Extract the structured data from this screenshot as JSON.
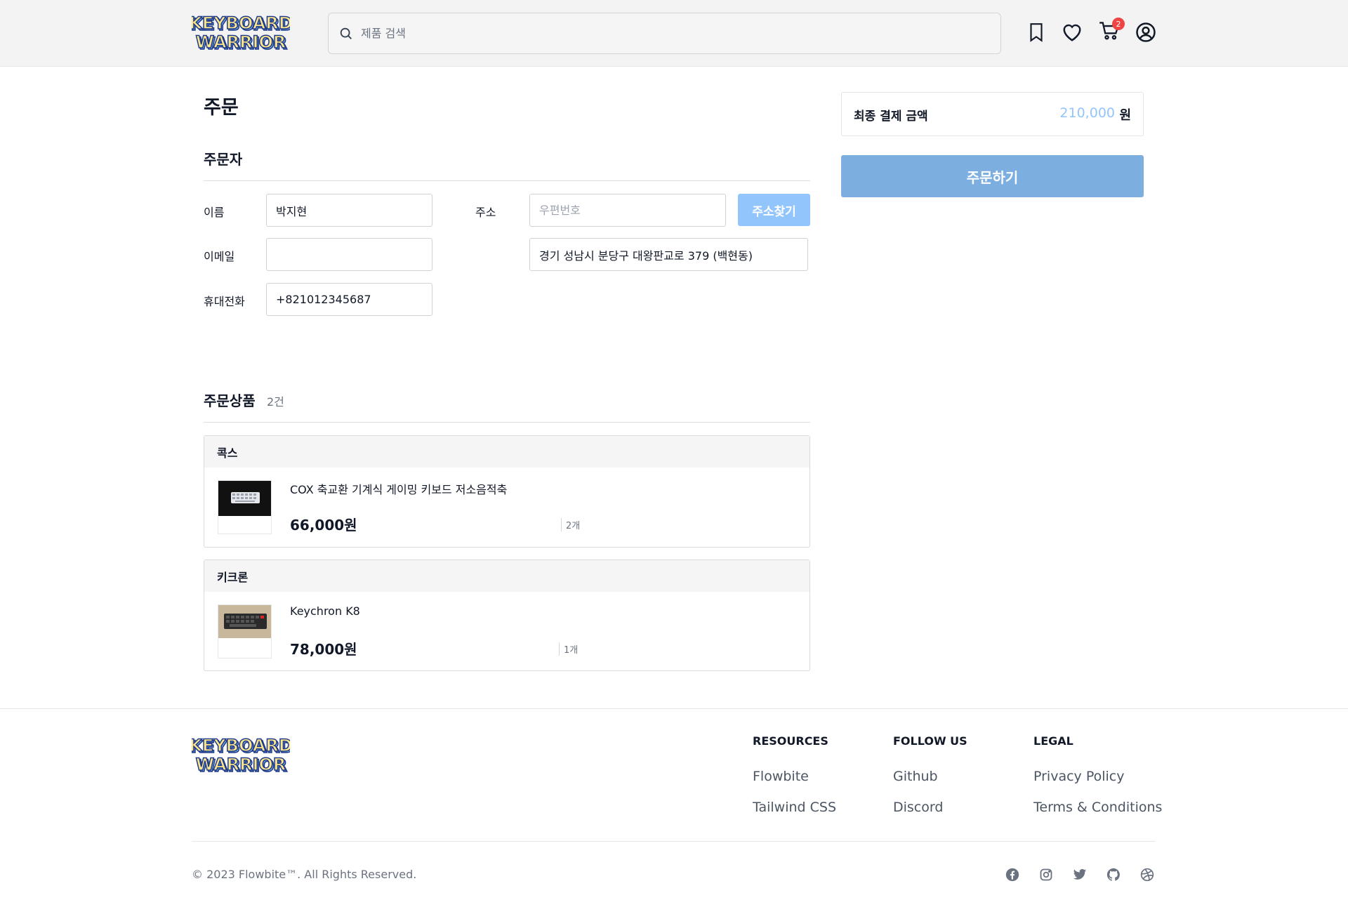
{
  "brand": {
    "line1": "KEYBOARD",
    "line2": "WARRIOR"
  },
  "search": {
    "placeholder": "제품 검색"
  },
  "cart": {
    "count": "2"
  },
  "page": {
    "title": "주문"
  },
  "orderer": {
    "title": "주문자",
    "name_label": "이름",
    "name_value": "박지현",
    "email_label": "이메일",
    "email_value": "",
    "phone_label": "휴대전화",
    "phone_value": "+821012345687",
    "address_label": "주소",
    "postcode_placeholder": "우편번호",
    "address_value": "경기 성남시 분당구 대왕판교로 379 (백현동)",
    "find_address_label": "주소찾기"
  },
  "items": {
    "title": "주문상품",
    "count": "2건",
    "stores": [
      {
        "store": "콕스",
        "name": "COX 축교환 기계식 게이밍 키보드 저소음적축",
        "price": "66,000원",
        "qty": "2개"
      },
      {
        "store": "키크론",
        "name": "Keychron K8",
        "price": "78,000원",
        "qty": "1개"
      }
    ]
  },
  "summary": {
    "label": "최종 결제 금액",
    "amount": "210,000",
    "currency": "원",
    "order_button": "주문하기"
  },
  "footer": {
    "resources": {
      "title": "RESOURCES",
      "links": [
        "Flowbite",
        "Tailwind CSS"
      ]
    },
    "follow": {
      "title": "FOLLOW US",
      "links": [
        "Github",
        "Discord"
      ]
    },
    "legal": {
      "title": "LEGAL",
      "links": [
        "Privacy Policy",
        "Terms & Conditions"
      ]
    },
    "copyright": "© 2023 Flowbite™. All Rights Reserved."
  },
  "colors": {
    "accent": "#93c5fd",
    "order_button": "#7daee0",
    "badge": "#ef4444",
    "logo_fill": "#fde68a",
    "logo_stroke": "#1e3a8a"
  },
  "icons": [
    "search-icon",
    "bookmark-icon",
    "heart-icon",
    "cart-icon",
    "user-icon",
    "facebook-icon",
    "instagram-icon",
    "twitter-icon",
    "github-icon",
    "dribbble-icon"
  ]
}
